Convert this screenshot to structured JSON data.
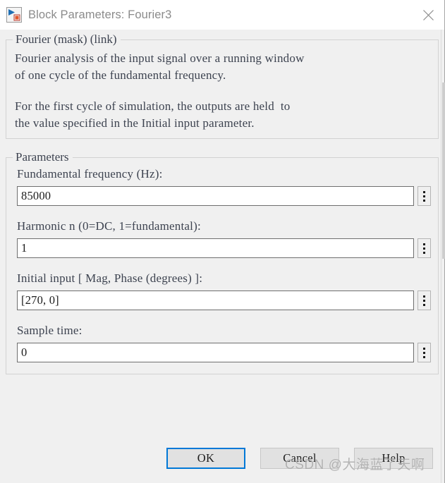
{
  "window": {
    "title": "Block Parameters: Fourier3",
    "icon": "simulink-block-icon",
    "close_icon": "close-icon"
  },
  "description": {
    "legend": "Fourier (mask) (link)",
    "paragraphs": [
      "Fourier analysis of the input signal over a running window\nof one cycle of the fundamental frequency.",
      "For the first cycle of simulation, the outputs are held  to\nthe value specified in the Initial input parameter."
    ]
  },
  "parameters": {
    "legend": "Parameters",
    "fields": [
      {
        "label": "Fundamental frequency (Hz):",
        "value": "85000",
        "placeholder": "",
        "name": "fundamental-frequency"
      },
      {
        "label": "Harmonic n (0=DC, 1=fundamental):",
        "value": "1",
        "placeholder": "",
        "name": "harmonic-n"
      },
      {
        "label": "Initial input [ Mag, Phase (degrees) ]:",
        "value": "[270, 0]",
        "placeholder": "",
        "name": "initial-input"
      },
      {
        "label": "Sample time:",
        "value": "0",
        "placeholder": "",
        "name": "sample-time"
      }
    ],
    "dots_button_label": "⋮"
  },
  "footer": {
    "ok_label": "OK",
    "cancel_label": "Cancel",
    "help_label": "Help"
  },
  "watermark": {
    "text": "CSDN @大海蓝了天啊"
  },
  "colors": {
    "dialog_background": "#f0f0f0",
    "titlebar_background": "#ffffff",
    "title_text": "#8b8b8b",
    "body_text": "#3d4350",
    "input_background": "#ffffff",
    "input_border": "#6f6f6f",
    "default_button_border": "#0078d7",
    "button_background": "#e1e1e1",
    "group_border": "#d2d2d2"
  }
}
